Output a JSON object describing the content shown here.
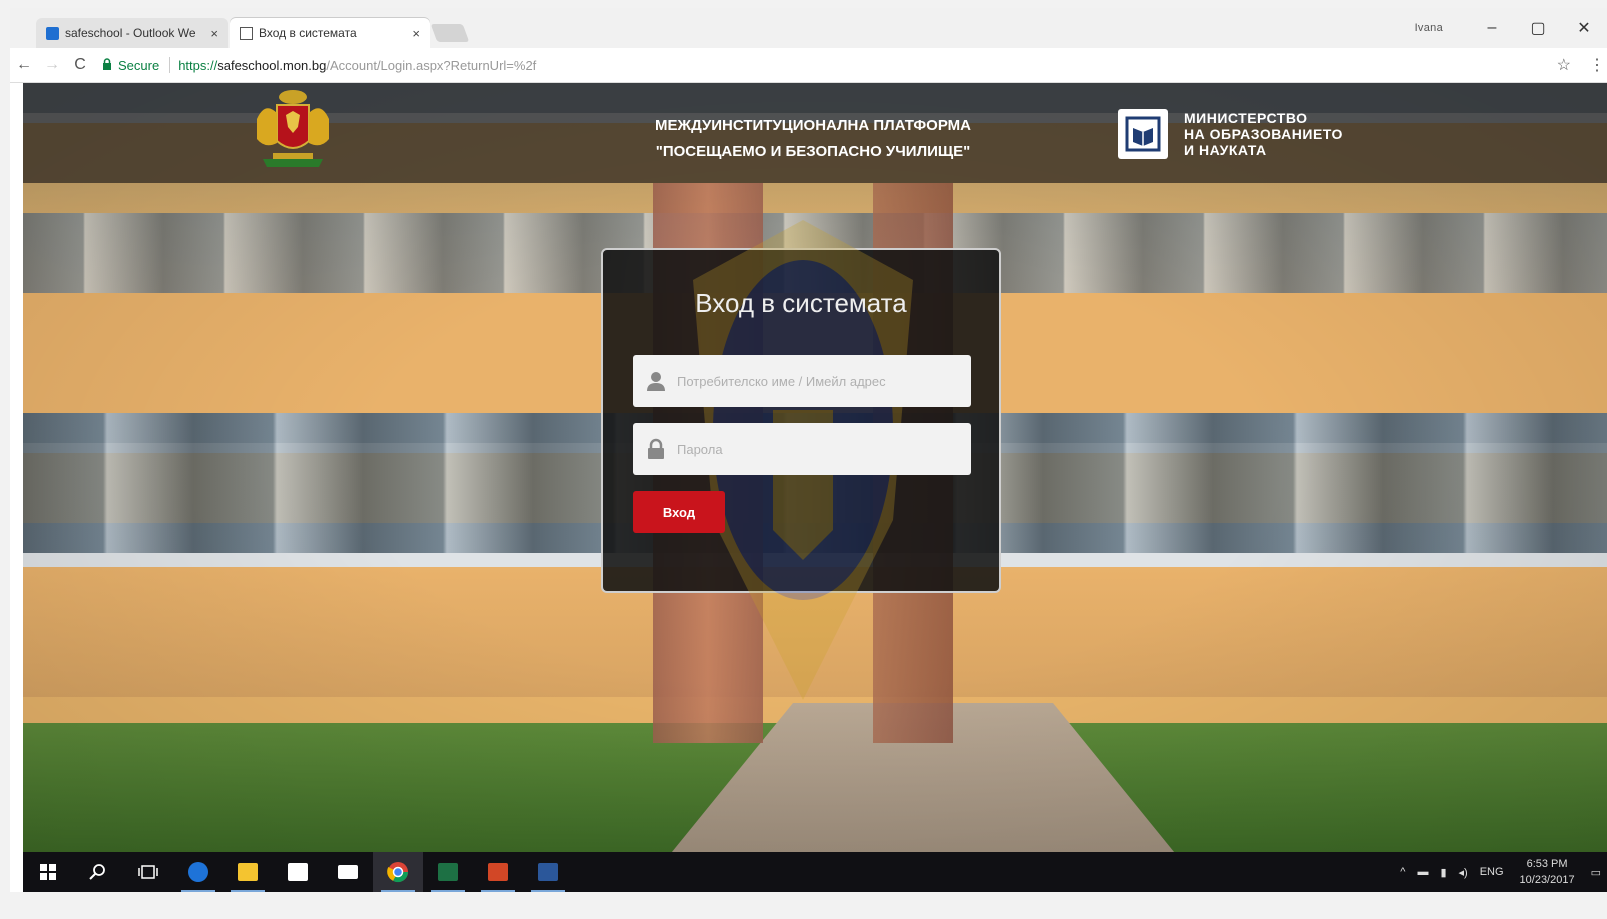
{
  "browser": {
    "tabs": [
      {
        "title": "safeschool - Outlook We",
        "close": "×",
        "icon": "outlook-icon"
      },
      {
        "title": "Вход в системата",
        "close": "×",
        "icon": "page-icon"
      }
    ],
    "profile": "Ivana",
    "window_controls": {
      "minimize": "–",
      "maximize": "▢",
      "close": "✕"
    },
    "nav": {
      "back": "←",
      "forward": "→",
      "reload": "C"
    },
    "security_label": "Secure",
    "url": {
      "scheme": "https://",
      "host": "safeschool.mon.bg",
      "path": "/Account/Login.aspx?ReturnUrl=%2f"
    },
    "bookmark_star": "☆",
    "menu": "⋮"
  },
  "header": {
    "platform_line1": "МЕЖДУИНСТИТУЦИОНАЛНА ПЛАТФОРМА",
    "platform_line2": "\"ПОСЕЩАЕМО И БЕЗОПАСНО УЧИЛИЩЕ\"",
    "ministry_line1": "МИНИСТЕРСТВО",
    "ministry_line2": "НА ОБРАЗОВАНИЕТО",
    "ministry_line3": "И НАУКАТА"
  },
  "login": {
    "title": "Вход в системата",
    "username_placeholder": "Потребителско име / Имейл адрес",
    "password_placeholder": "Парола",
    "submit_label": "Вход"
  },
  "taskbar": {
    "apps": [
      "start-icon",
      "search-icon",
      "task-view-icon",
      "edge-icon",
      "file-explorer-icon",
      "store-icon",
      "mail-icon",
      "chrome-icon",
      "excel-icon",
      "powerpoint-icon",
      "word-icon"
    ],
    "tray_language": "ENG",
    "time": "6:53 PM",
    "date": "10/23/2017"
  },
  "colors": {
    "accent": "#c9141c",
    "secure": "#0b8043",
    "taskbar": "#101014"
  }
}
